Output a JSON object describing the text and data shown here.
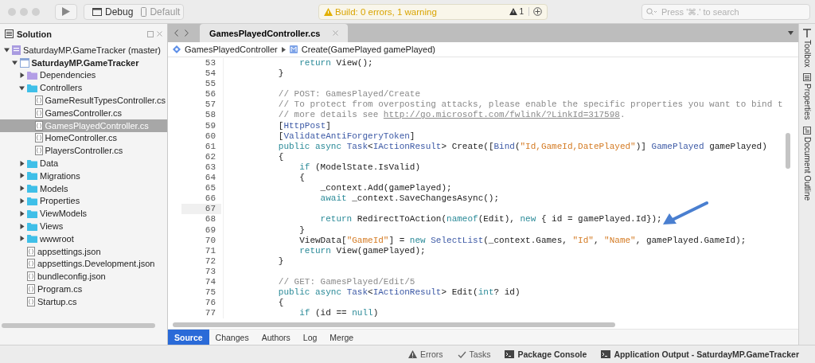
{
  "toolbar": {
    "configuration": "Debug",
    "target": "Default",
    "build_status": "Build: 0 errors, 1 warning",
    "warning_count": "1",
    "search": {
      "placeholder": "Press '⌘.' to search"
    }
  },
  "solution_pad": {
    "title": "Solution",
    "tree": [
      {
        "kind": "solution",
        "label": "SaturdayMP.GameTracker (master)",
        "expanded": true,
        "selected": false,
        "children": [
          {
            "kind": "project",
            "label": "SaturdayMP.GameTracker",
            "expanded": true,
            "selected": false,
            "children": [
              {
                "kind": "dependencies",
                "label": "Dependencies",
                "expanded": false,
                "selected": false
              },
              {
                "kind": "folder",
                "label": "Controllers",
                "expanded": true,
                "selected": false,
                "children": [
                  {
                    "kind": "file",
                    "label": "GameResultTypesController.cs",
                    "selected": false
                  },
                  {
                    "kind": "file",
                    "label": "GamesController.cs",
                    "selected": false
                  },
                  {
                    "kind": "file",
                    "label": "GamesPlayedController.cs",
                    "selected": true
                  },
                  {
                    "kind": "file",
                    "label": "HomeController.cs",
                    "selected": false
                  },
                  {
                    "kind": "file",
                    "label": "PlayersController.cs",
                    "selected": false
                  }
                ]
              },
              {
                "kind": "folder",
                "label": "Data",
                "expanded": false,
                "selected": false
              },
              {
                "kind": "folder",
                "label": "Migrations",
                "expanded": false,
                "selected": false
              },
              {
                "kind": "folder",
                "label": "Models",
                "expanded": false,
                "selected": false
              },
              {
                "kind": "folder",
                "label": "Properties",
                "expanded": false,
                "selected": false
              },
              {
                "kind": "folder",
                "label": "ViewModels",
                "expanded": false,
                "selected": false
              },
              {
                "kind": "folder",
                "label": "Views",
                "expanded": false,
                "selected": false
              },
              {
                "kind": "folder",
                "label": "wwwroot",
                "expanded": false,
                "selected": false
              },
              {
                "kind": "file",
                "label": "appsettings.json",
                "selected": false
              },
              {
                "kind": "file",
                "label": "appsettings.Development.json",
                "selected": false
              },
              {
                "kind": "file",
                "label": "bundleconfig.json",
                "selected": false
              },
              {
                "kind": "file",
                "label": "Program.cs",
                "selected": false
              },
              {
                "kind": "file",
                "label": "Startup.cs",
                "selected": false
              }
            ]
          }
        ]
      }
    ]
  },
  "editor": {
    "tab": "GamesPlayedController.cs",
    "breadcrumb": {
      "class": "GamesPlayedController",
      "method": "Create(GamePlayed gamePlayed)"
    },
    "lines": [
      {
        "number": "53",
        "tokens": [
          {
            "kind": "keyword",
            "text": "            return"
          },
          {
            "kind": "plain",
            "text": " View();"
          }
        ]
      },
      {
        "number": "54",
        "tokens": [
          {
            "kind": "plain",
            "text": "        }"
          }
        ]
      },
      {
        "number": "55"
      },
      {
        "number": "56",
        "tokens": [
          {
            "kind": "comment",
            "text": "        // POST: GamesPlayed/Create"
          }
        ]
      },
      {
        "number": "57",
        "tokens": [
          {
            "kind": "comment",
            "text": "        // To protect from overposting attacks, please enable the specific properties you want to bind t"
          }
        ]
      },
      {
        "number": "58",
        "tokens": [
          {
            "kind": "comment",
            "text": "        // more details see "
          },
          {
            "kind": "link",
            "text": "http://go.microsoft.com/fwlink/?LinkId=317598"
          },
          {
            "kind": "comment",
            "text": "."
          }
        ]
      },
      {
        "number": "59",
        "tokens": [
          {
            "kind": "plain",
            "text": "        ["
          },
          {
            "kind": "type",
            "text": "HttpPost"
          },
          {
            "kind": "plain",
            "text": "]"
          }
        ]
      },
      {
        "number": "60",
        "tokens": [
          {
            "kind": "plain",
            "text": "        ["
          },
          {
            "kind": "type",
            "text": "ValidateAntiForgeryToken"
          },
          {
            "kind": "plain",
            "text": "]"
          }
        ]
      },
      {
        "number": "61",
        "tokens": [
          {
            "kind": "keyword",
            "text": "        public async "
          },
          {
            "kind": "type",
            "text": "Task"
          },
          {
            "kind": "plain",
            "text": "<"
          },
          {
            "kind": "type",
            "text": "IActionResult"
          },
          {
            "kind": "plain",
            "text": "> Create(["
          },
          {
            "kind": "type",
            "text": "Bind"
          },
          {
            "kind": "plain",
            "text": "("
          },
          {
            "kind": "string",
            "text": "\"Id,GameId,DatePlayed\""
          },
          {
            "kind": "plain",
            "text": ")] "
          },
          {
            "kind": "type",
            "text": "GamePlayed"
          },
          {
            "kind": "plain",
            "text": " gamePlayed)"
          }
        ]
      },
      {
        "number": "62",
        "tokens": [
          {
            "kind": "plain",
            "text": "        {"
          }
        ]
      },
      {
        "number": "63",
        "tokens": [
          {
            "kind": "keyword",
            "text": "            if"
          },
          {
            "kind": "plain",
            "text": " (ModelState.IsValid)"
          }
        ]
      },
      {
        "number": "64",
        "tokens": [
          {
            "kind": "plain",
            "text": "            {"
          }
        ]
      },
      {
        "number": "65",
        "tokens": [
          {
            "kind": "plain",
            "text": "                _context.Add(gamePlayed);"
          }
        ]
      },
      {
        "number": "66",
        "tokens": [
          {
            "kind": "keyword",
            "text": "                await"
          },
          {
            "kind": "plain",
            "text": " _context.SaveChangesAsync();"
          }
        ]
      },
      {
        "number": "67",
        "current": true
      },
      {
        "number": "68",
        "tokens": [
          {
            "kind": "keyword",
            "text": "                return"
          },
          {
            "kind": "plain",
            "text": " RedirectToAction("
          },
          {
            "kind": "keyword",
            "text": "nameof"
          },
          {
            "kind": "plain",
            "text": "(Edit), "
          },
          {
            "kind": "keyword",
            "text": "new"
          },
          {
            "kind": "plain",
            "text": " { id = gamePlayed.Id});"
          }
        ]
      },
      {
        "number": "69",
        "tokens": [
          {
            "kind": "plain",
            "text": "            }"
          }
        ]
      },
      {
        "number": "70",
        "tokens": [
          {
            "kind": "plain",
            "text": "            ViewData["
          },
          {
            "kind": "string",
            "text": "\"GameId\""
          },
          {
            "kind": "plain",
            "text": "] = "
          },
          {
            "kind": "keyword",
            "text": "new "
          },
          {
            "kind": "type",
            "text": "SelectList"
          },
          {
            "kind": "plain",
            "text": "(_context.Games, "
          },
          {
            "kind": "string",
            "text": "\"Id\""
          },
          {
            "kind": "plain",
            "text": ", "
          },
          {
            "kind": "string",
            "text": "\"Name\""
          },
          {
            "kind": "plain",
            "text": ", gamePlayed.GameId);"
          }
        ]
      },
      {
        "number": "71",
        "tokens": [
          {
            "kind": "keyword",
            "text": "            return"
          },
          {
            "kind": "plain",
            "text": " View(gamePlayed);"
          }
        ]
      },
      {
        "number": "72",
        "tokens": [
          {
            "kind": "plain",
            "text": "        }"
          }
        ]
      },
      {
        "number": "73"
      },
      {
        "number": "74",
        "tokens": [
          {
            "kind": "comment",
            "text": "        // GET: GamesPlayed/Edit/5"
          }
        ]
      },
      {
        "number": "75",
        "tokens": [
          {
            "kind": "keyword",
            "text": "        public async "
          },
          {
            "kind": "type",
            "text": "Task"
          },
          {
            "kind": "plain",
            "text": "<"
          },
          {
            "kind": "type",
            "text": "IActionResult"
          },
          {
            "kind": "plain",
            "text": "> Edit("
          },
          {
            "kind": "keyword",
            "text": "int"
          },
          {
            "kind": "plain",
            "text": "? id)"
          }
        ]
      },
      {
        "number": "76",
        "tokens": [
          {
            "kind": "plain",
            "text": "        {"
          }
        ]
      },
      {
        "number": "77",
        "tokens": [
          {
            "kind": "keyword",
            "text": "            if"
          },
          {
            "kind": "plain",
            "text": " (id == "
          },
          {
            "kind": "keyword",
            "text": "null"
          },
          {
            "kind": "plain",
            "text": ")"
          }
        ]
      }
    ],
    "view_tabs": [
      {
        "label": "Source",
        "selected": true
      },
      {
        "label": "Changes",
        "selected": false
      },
      {
        "label": "Authors",
        "selected": false
      },
      {
        "label": "Log",
        "selected": false
      },
      {
        "label": "Merge",
        "selected": false
      }
    ]
  },
  "side_pads": [
    {
      "kind": "toolbox",
      "label": "Toolbox"
    },
    {
      "kind": "properties",
      "label": "Properties"
    },
    {
      "kind": "outline",
      "label": "Document Outline"
    }
  ],
  "status_bar": [
    {
      "kind": "errors",
      "label": "Errors"
    },
    {
      "kind": "tasks",
      "label": "Tasks"
    },
    {
      "kind": "console",
      "label": "Package Console"
    },
    {
      "kind": "console",
      "label": "Application Output - SaturdayMP.GameTracker"
    }
  ]
}
